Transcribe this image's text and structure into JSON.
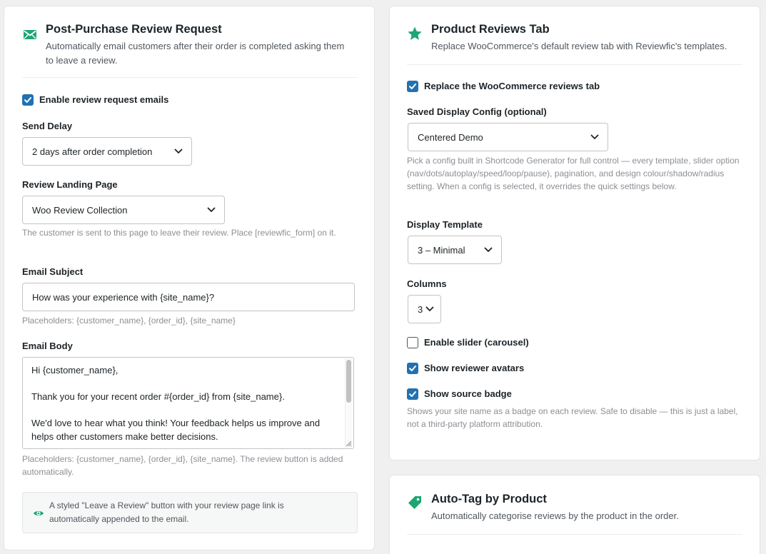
{
  "review_request": {
    "title": "Post-Purchase Review Request",
    "description": "Automatically email customers after their order is completed asking them to leave a review.",
    "enable_label": "Enable review request emails",
    "enable_checked": true,
    "send_delay_label": "Send Delay",
    "send_delay_value": "2 days after order completion",
    "landing_label": "Review Landing Page",
    "landing_value": "Woo Review Collection",
    "landing_help": "The customer is sent to this page to leave their review. Place [reviewfic_form] on it.",
    "subject_label": "Email Subject",
    "subject_value": "How was your experience with {site_name}?",
    "subject_help": "Placeholders: {customer_name}, {order_id}, {site_name}",
    "body_label": "Email Body",
    "body_lines": [
      "Hi {customer_name},",
      "Thank you for your recent order #{order_id} from {site_name}.",
      "We'd love to hear what you think! Your feedback helps us improve and helps other customers make better decisions."
    ],
    "body_help": "Placeholders: {customer_name}, {order_id}, {site_name}. The review button is added automatically.",
    "notice_text": "A styled \"Leave a Review\" button with your review page link is automatically appended to the email."
  },
  "reviews_tab": {
    "title": "Product Reviews Tab",
    "description": "Replace WooCommerce's default review tab with Reviewfic's templates.",
    "replace_label": "Replace the WooCommerce reviews tab",
    "replace_checked": true,
    "config_label": "Saved Display Config (optional)",
    "config_value": "Centered Demo",
    "config_help": "Pick a config built in Shortcode Generator for full control — every template, slider option (nav/dots/autoplay/speed/loop/pause), pagination, and design colour/shadow/radius setting. When a config is selected, it overrides the quick settings below.",
    "template_label": "Display Template",
    "template_value": "3 – Minimal",
    "columns_label": "Columns",
    "columns_value": "3",
    "slider_label": "Enable slider (carousel)",
    "slider_checked": false,
    "avatars_label": "Show reviewer avatars",
    "avatars_checked": true,
    "badge_label": "Show source badge",
    "badge_checked": true,
    "badge_help": "Shows your site name as a badge on each review. Safe to disable — this is just a label, not a third-party platform attribution."
  },
  "auto_tag": {
    "title": "Auto-Tag by Product",
    "description": "Automatically categorise reviews by the product in the order."
  },
  "colors": {
    "accent_green": "#1ea672",
    "checkbox_blue": "#2271b1"
  },
  "icons": {
    "review_request": "envelope-icon",
    "reviews_tab": "star-icon",
    "auto_tag": "tag-icon",
    "notice": "eye-icon"
  }
}
